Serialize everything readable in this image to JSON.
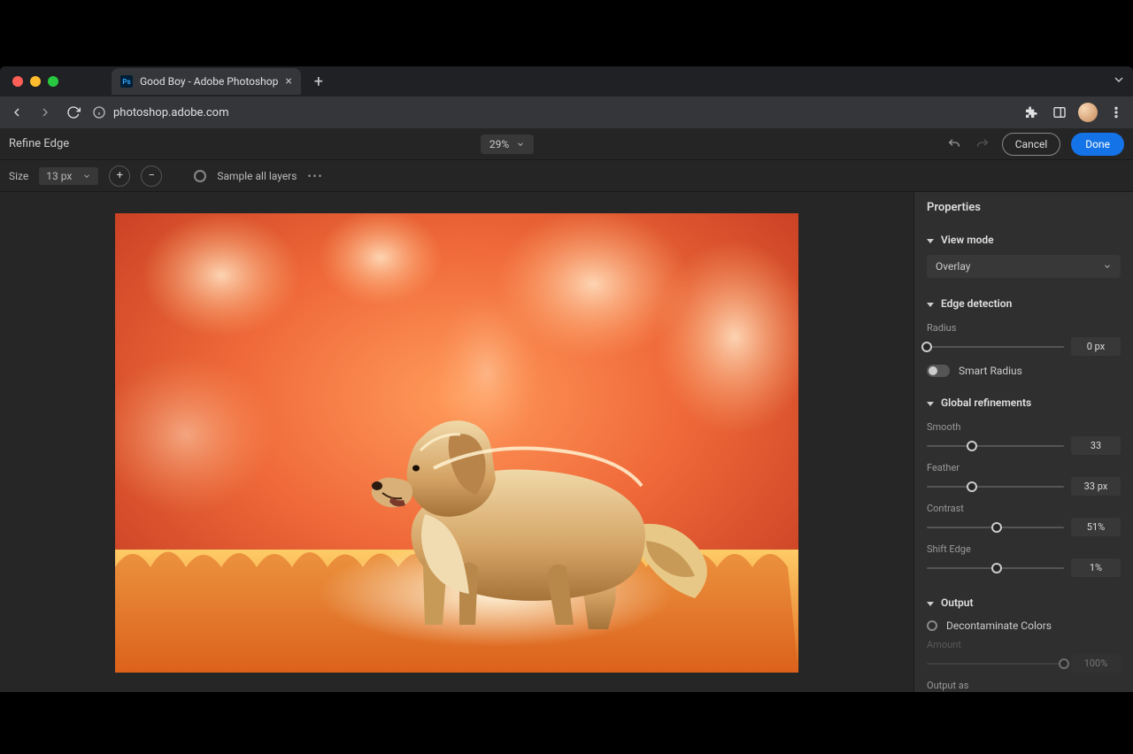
{
  "browser": {
    "tab_title": "Good Boy - Adobe Photoshop",
    "url_host": "photoshop.adobe.com",
    "url_path": ""
  },
  "header": {
    "mode_title": "Refine Edge",
    "zoom": "29%",
    "cancel": "Cancel",
    "done": "Done"
  },
  "options": {
    "size_label": "Size",
    "size_value": "13 px",
    "sample_all_layers": "Sample all layers"
  },
  "properties": {
    "title": "Properties",
    "view_mode": {
      "label": "View mode",
      "value": "Overlay"
    },
    "edge_detection": {
      "label": "Edge detection",
      "radius_label": "Radius",
      "radius_value": "0 px",
      "radius_pct": 0,
      "smart_radius": "Smart Radius"
    },
    "global_refinements": {
      "label": "Global refinements",
      "smooth_label": "Smooth",
      "smooth_value": "33",
      "smooth_pct": 33,
      "feather_label": "Feather",
      "feather_value": "33 px",
      "feather_pct": 33,
      "contrast_label": "Contrast",
      "contrast_value": "51%",
      "contrast_pct": 51,
      "shift_edge_label": "Shift Edge",
      "shift_edge_value": "1%",
      "shift_edge_pct": 51
    },
    "output": {
      "label": "Output",
      "decontaminate": "Decontaminate Colors",
      "amount_label": "Amount",
      "amount_value": "100%",
      "amount_pct": 100,
      "output_as_label": "Output as"
    }
  }
}
